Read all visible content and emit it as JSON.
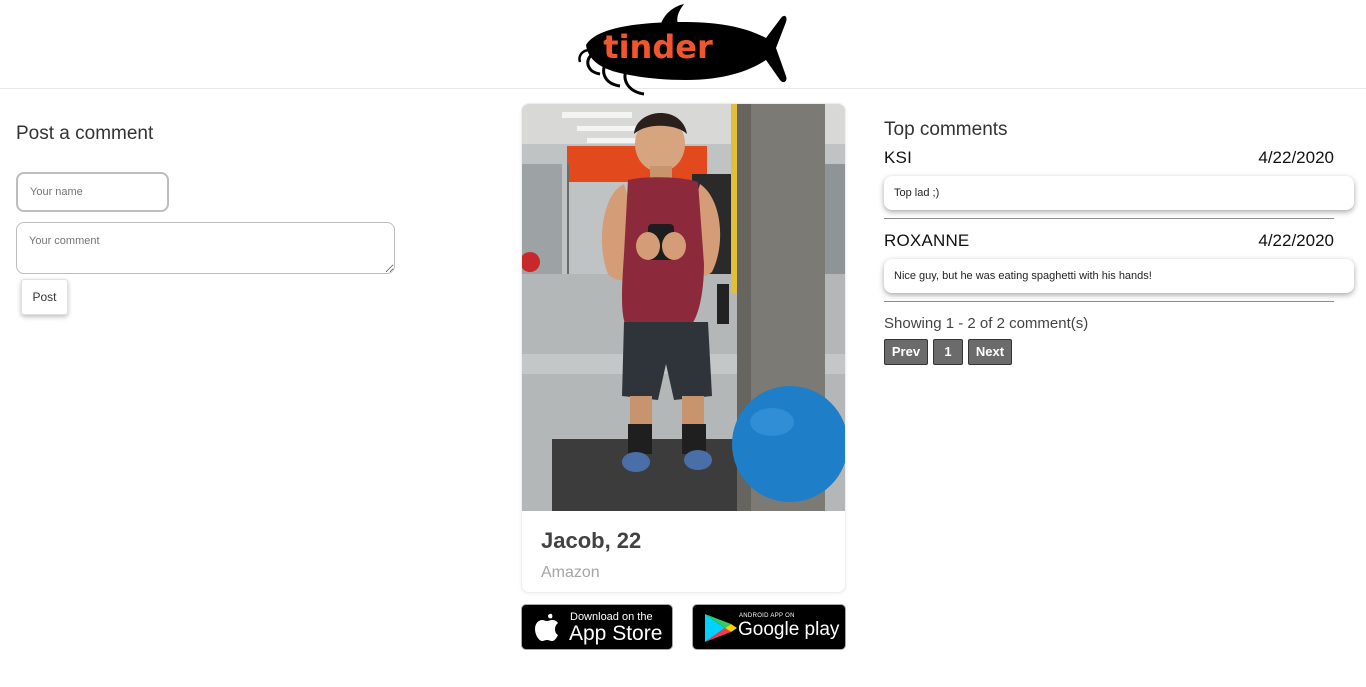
{
  "header": {
    "logo_text": "tinder",
    "colors": {
      "logo_fish": "#000000",
      "logo_text": "#f0562d"
    }
  },
  "post": {
    "title": "Post a comment",
    "name_placeholder": "Your name",
    "comment_placeholder": "Your comment",
    "post_label": "Post"
  },
  "profile": {
    "name_age": "Jacob, 22",
    "job": "Amazon",
    "photo_icon": "gym-selfie-photo"
  },
  "apps": {
    "appstore_small": "Download on the",
    "appstore_big": "App Store",
    "google_small": "ANDROID APP ON",
    "google_big": "Google play"
  },
  "comments": {
    "title": "Top comments",
    "items": [
      {
        "author": "KSI",
        "date": "4/22/2020",
        "text": "Top lad ;)"
      },
      {
        "author": "ROXANNE",
        "date": "4/22/2020",
        "text": "Nice guy, but he was eating spaghetti with his hands!"
      }
    ],
    "showing": "Showing 1 - 2 of 2 comment(s)",
    "pagination": {
      "prev": "Prev",
      "page": "1",
      "next": "Next"
    }
  }
}
